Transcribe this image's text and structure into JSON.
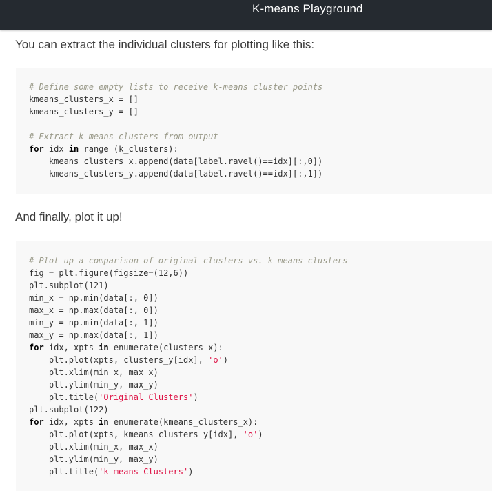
{
  "header": {
    "title": "K-means Playground"
  },
  "paragraphs": {
    "intro": "You can extract the individual clusters for plotting like this:",
    "finally": "And finally, plot it up!"
  },
  "code1": {
    "lines": [
      [
        {
          "t": "# Define some empty lists to receive k-means cluster points",
          "k": "comment"
        }
      ],
      [
        {
          "t": "kmeans_clusters_x = []",
          "k": "plain"
        }
      ],
      [
        {
          "t": "kmeans_clusters_y = []",
          "k": "plain"
        }
      ],
      [],
      [
        {
          "t": "# Extract k-means clusters from output",
          "k": "comment"
        }
      ],
      [
        {
          "t": "for",
          "k": "kw"
        },
        {
          "t": " idx ",
          "k": "plain"
        },
        {
          "t": "in",
          "k": "kw"
        },
        {
          "t": " range (k_clusters):",
          "k": "plain"
        }
      ],
      [
        {
          "t": "    kmeans_clusters_x.append(data[label.ravel()==idx][:,0])",
          "k": "plain"
        }
      ],
      [
        {
          "t": "    kmeans_clusters_y.append(data[label.ravel()==idx][:,1])",
          "k": "plain"
        }
      ]
    ]
  },
  "code2": {
    "lines": [
      [
        {
          "t": "# Plot up a comparison of original clusters vs. k-means clusters",
          "k": "comment"
        }
      ],
      [
        {
          "t": "fig = plt.figure(figsize=(12,6))",
          "k": "plain"
        }
      ],
      [
        {
          "t": "plt.subplot(121)",
          "k": "plain"
        }
      ],
      [
        {
          "t": "min_x = np.min(data[:, 0])",
          "k": "plain"
        }
      ],
      [
        {
          "t": "max_x = np.max(data[:, 0])",
          "k": "plain"
        }
      ],
      [
        {
          "t": "min_y = np.min(data[:, 1])",
          "k": "plain"
        }
      ],
      [
        {
          "t": "max_y = np.max(data[:, 1])",
          "k": "plain"
        }
      ],
      [
        {
          "t": "for",
          "k": "kw"
        },
        {
          "t": " idx, xpts ",
          "k": "plain"
        },
        {
          "t": "in",
          "k": "kw"
        },
        {
          "t": " enumerate(clusters_x):",
          "k": "plain"
        }
      ],
      [
        {
          "t": "    plt.plot(xpts, clusters_y[idx], ",
          "k": "plain"
        },
        {
          "t": "'o'",
          "k": "str"
        },
        {
          "t": ")",
          "k": "plain"
        }
      ],
      [
        {
          "t": "    plt.xlim(min_x, max_x)",
          "k": "plain"
        }
      ],
      [
        {
          "t": "    plt.ylim(min_y, max_y)",
          "k": "plain"
        }
      ],
      [
        {
          "t": "    plt.title(",
          "k": "plain"
        },
        {
          "t": "'Original Clusters'",
          "k": "str"
        },
        {
          "t": ")",
          "k": "plain"
        }
      ],
      [
        {
          "t": "plt.subplot(122)",
          "k": "plain"
        }
      ],
      [
        {
          "t": "for",
          "k": "kw"
        },
        {
          "t": " idx, xpts ",
          "k": "plain"
        },
        {
          "t": "in",
          "k": "kw"
        },
        {
          "t": " enumerate(kmeans_clusters_x):",
          "k": "plain"
        }
      ],
      [
        {
          "t": "    plt.plot(xpts, kmeans_clusters_y[idx], ",
          "k": "plain"
        },
        {
          "t": "'o'",
          "k": "str"
        },
        {
          "t": ")",
          "k": "plain"
        }
      ],
      [
        {
          "t": "    plt.xlim(min_x, max_x)",
          "k": "plain"
        }
      ],
      [
        {
          "t": "    plt.ylim(min_y, max_y)",
          "k": "plain"
        }
      ],
      [
        {
          "t": "    plt.title(",
          "k": "plain"
        },
        {
          "t": "'k-means Clusters'",
          "k": "str"
        },
        {
          "t": ")",
          "k": "plain"
        }
      ]
    ]
  },
  "colors": {
    "header_bg": "#252a30",
    "code_bg": "#f8f8f8",
    "comment": "#999988",
    "string": "#d14"
  }
}
